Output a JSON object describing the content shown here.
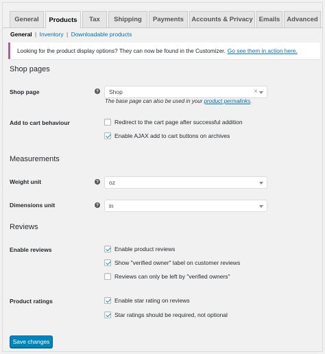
{
  "tabs": [
    "General",
    "Products",
    "Tax",
    "Shipping",
    "Payments",
    "Accounts & Privacy",
    "Emails",
    "Advanced"
  ],
  "active_tab": "Products",
  "subnav": {
    "current": "General",
    "links": [
      "Inventory",
      "Downloadable products"
    ],
    "separator": "|"
  },
  "notice": {
    "text": "Looking for the product display options? They can now be found in the Customizer.",
    "link": "Go see them in action here."
  },
  "sections": {
    "shop_pages": "Shop pages",
    "measurements": "Measurements",
    "reviews": "Reviews"
  },
  "shop_page": {
    "label": "Shop page",
    "value": "Shop",
    "clear": "×",
    "desc_prefix": "The base page can also be used in your",
    "desc_link": "product permalinks",
    "desc_suffix": "."
  },
  "add_to_cart": {
    "label": "Add to cart behaviour",
    "options": [
      {
        "label": "Redirect to the cart page after successful addition",
        "checked": false
      },
      {
        "label": "Enable AJAX add to cart buttons on archives",
        "checked": true
      }
    ]
  },
  "weight_unit": {
    "label": "Weight unit",
    "value": "oz"
  },
  "dimensions_unit": {
    "label": "Dimensions unit",
    "value": "in"
  },
  "enable_reviews": {
    "label": "Enable reviews",
    "options": [
      {
        "label": "Enable product reviews",
        "checked": true
      },
      {
        "label": "Show \"verified owner\" label on customer reviews",
        "checked": true
      },
      {
        "label": "Reviews can only be left by \"verified owners\"",
        "checked": false
      }
    ]
  },
  "product_ratings": {
    "label": "Product ratings",
    "options": [
      {
        "label": "Enable star rating on reviews",
        "checked": true
      },
      {
        "label": "Star ratings should be required, not optional",
        "checked": true
      }
    ]
  },
  "help_glyph": "?",
  "save_label": "Save changes",
  "colors": {
    "accent": "#0085ba",
    "link": "#0073aa",
    "notice_border": "#a46497",
    "check": "#1e8cbe"
  }
}
